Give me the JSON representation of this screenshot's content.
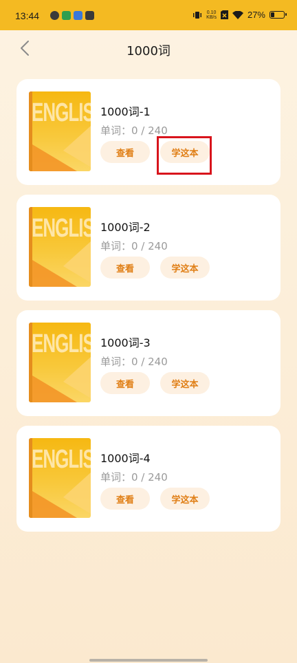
{
  "status_bar": {
    "time": "13:44",
    "net_speed_value": "0.10",
    "net_speed_unit": "KB/s",
    "battery_percent": "27%",
    "battery_level": 0.27
  },
  "header": {
    "title": "1000词"
  },
  "books": [
    {
      "name": "1000词-1",
      "count": "单词：0 / 240",
      "view_label": "查看",
      "learn_label": "学这本",
      "cover_text": "ENGLISH"
    },
    {
      "name": "1000词-2",
      "count": "单词：0 / 240",
      "view_label": "查看",
      "learn_label": "学这本",
      "cover_text": "ENGLISH"
    },
    {
      "name": "1000词-3",
      "count": "单词：0 / 240",
      "view_label": "查看",
      "learn_label": "学这本",
      "cover_text": "ENGLISH"
    },
    {
      "name": "1000词-4",
      "count": "单词：0 / 240",
      "view_label": "查看",
      "learn_label": "学这本",
      "cover_text": "ENGLISH"
    }
  ],
  "colors": {
    "accent": "#f4ba22",
    "button_text": "#e07f16",
    "highlight": "#d8141c"
  }
}
